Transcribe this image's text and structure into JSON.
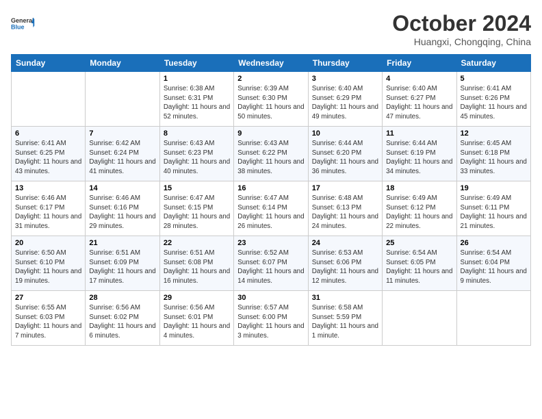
{
  "logo": {
    "line1": "General",
    "line2": "Blue"
  },
  "title": "October 2024",
  "location": "Huangxi, Chongqing, China",
  "weekdays": [
    "Sunday",
    "Monday",
    "Tuesday",
    "Wednesday",
    "Thursday",
    "Friday",
    "Saturday"
  ],
  "weeks": [
    [
      null,
      null,
      {
        "day": 1,
        "sunrise": "6:38 AM",
        "sunset": "6:31 PM",
        "daylight": "11 hours and 52 minutes."
      },
      {
        "day": 2,
        "sunrise": "6:39 AM",
        "sunset": "6:30 PM",
        "daylight": "11 hours and 50 minutes."
      },
      {
        "day": 3,
        "sunrise": "6:40 AM",
        "sunset": "6:29 PM",
        "daylight": "11 hours and 49 minutes."
      },
      {
        "day": 4,
        "sunrise": "6:40 AM",
        "sunset": "6:27 PM",
        "daylight": "11 hours and 47 minutes."
      },
      {
        "day": 5,
        "sunrise": "6:41 AM",
        "sunset": "6:26 PM",
        "daylight": "11 hours and 45 minutes."
      }
    ],
    [
      {
        "day": 6,
        "sunrise": "6:41 AM",
        "sunset": "6:25 PM",
        "daylight": "11 hours and 43 minutes."
      },
      {
        "day": 7,
        "sunrise": "6:42 AM",
        "sunset": "6:24 PM",
        "daylight": "11 hours and 41 minutes."
      },
      {
        "day": 8,
        "sunrise": "6:43 AM",
        "sunset": "6:23 PM",
        "daylight": "11 hours and 40 minutes."
      },
      {
        "day": 9,
        "sunrise": "6:43 AM",
        "sunset": "6:22 PM",
        "daylight": "11 hours and 38 minutes."
      },
      {
        "day": 10,
        "sunrise": "6:44 AM",
        "sunset": "6:20 PM",
        "daylight": "11 hours and 36 minutes."
      },
      {
        "day": 11,
        "sunrise": "6:44 AM",
        "sunset": "6:19 PM",
        "daylight": "11 hours and 34 minutes."
      },
      {
        "day": 12,
        "sunrise": "6:45 AM",
        "sunset": "6:18 PM",
        "daylight": "11 hours and 33 minutes."
      }
    ],
    [
      {
        "day": 13,
        "sunrise": "6:46 AM",
        "sunset": "6:17 PM",
        "daylight": "11 hours and 31 minutes."
      },
      {
        "day": 14,
        "sunrise": "6:46 AM",
        "sunset": "6:16 PM",
        "daylight": "11 hours and 29 minutes."
      },
      {
        "day": 15,
        "sunrise": "6:47 AM",
        "sunset": "6:15 PM",
        "daylight": "11 hours and 28 minutes."
      },
      {
        "day": 16,
        "sunrise": "6:47 AM",
        "sunset": "6:14 PM",
        "daylight": "11 hours and 26 minutes."
      },
      {
        "day": 17,
        "sunrise": "6:48 AM",
        "sunset": "6:13 PM",
        "daylight": "11 hours and 24 minutes."
      },
      {
        "day": 18,
        "sunrise": "6:49 AM",
        "sunset": "6:12 PM",
        "daylight": "11 hours and 22 minutes."
      },
      {
        "day": 19,
        "sunrise": "6:49 AM",
        "sunset": "6:11 PM",
        "daylight": "11 hours and 21 minutes."
      }
    ],
    [
      {
        "day": 20,
        "sunrise": "6:50 AM",
        "sunset": "6:10 PM",
        "daylight": "11 hours and 19 minutes."
      },
      {
        "day": 21,
        "sunrise": "6:51 AM",
        "sunset": "6:09 PM",
        "daylight": "11 hours and 17 minutes."
      },
      {
        "day": 22,
        "sunrise": "6:51 AM",
        "sunset": "6:08 PM",
        "daylight": "11 hours and 16 minutes."
      },
      {
        "day": 23,
        "sunrise": "6:52 AM",
        "sunset": "6:07 PM",
        "daylight": "11 hours and 14 minutes."
      },
      {
        "day": 24,
        "sunrise": "6:53 AM",
        "sunset": "6:06 PM",
        "daylight": "11 hours and 12 minutes."
      },
      {
        "day": 25,
        "sunrise": "6:54 AM",
        "sunset": "6:05 PM",
        "daylight": "11 hours and 11 minutes."
      },
      {
        "day": 26,
        "sunrise": "6:54 AM",
        "sunset": "6:04 PM",
        "daylight": "11 hours and 9 minutes."
      }
    ],
    [
      {
        "day": 27,
        "sunrise": "6:55 AM",
        "sunset": "6:03 PM",
        "daylight": "11 hours and 7 minutes."
      },
      {
        "day": 28,
        "sunrise": "6:56 AM",
        "sunset": "6:02 PM",
        "daylight": "11 hours and 6 minutes."
      },
      {
        "day": 29,
        "sunrise": "6:56 AM",
        "sunset": "6:01 PM",
        "daylight": "11 hours and 4 minutes."
      },
      {
        "day": 30,
        "sunrise": "6:57 AM",
        "sunset": "6:00 PM",
        "daylight": "11 hours and 3 minutes."
      },
      {
        "day": 31,
        "sunrise": "6:58 AM",
        "sunset": "5:59 PM",
        "daylight": "11 hours and 1 minute."
      },
      null,
      null
    ]
  ],
  "labels": {
    "sunrise_prefix": "Sunrise: ",
    "sunset_prefix": "Sunset: ",
    "daylight_prefix": "Daylight: "
  }
}
